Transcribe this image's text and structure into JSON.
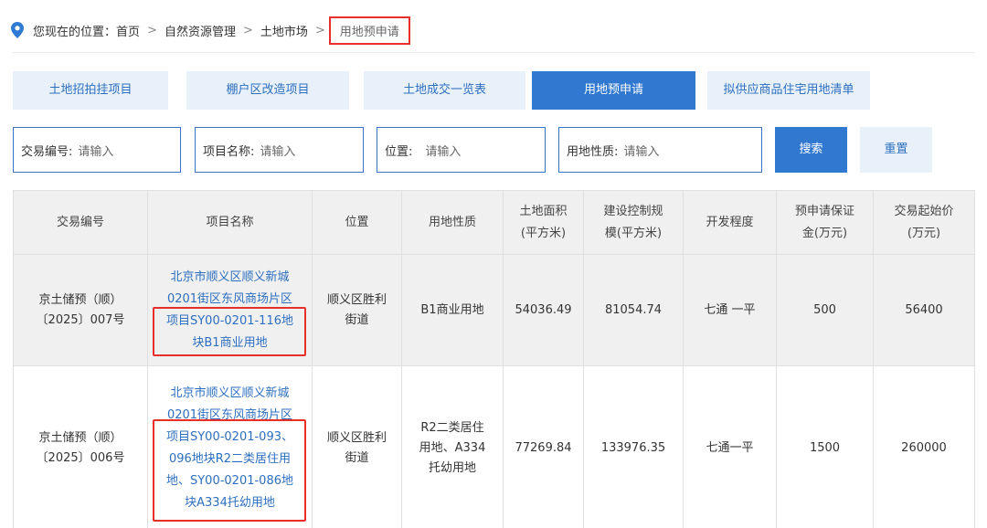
{
  "breadcrumb": {
    "prefix": "您现在的位置：",
    "items": [
      "首页",
      "自然资源管理",
      "土地市场"
    ],
    "current": "用地预申请",
    "separator": ">"
  },
  "tabs": [
    {
      "label": "土地招拍挂项目",
      "active": false
    },
    {
      "label": "棚户区改造项目",
      "active": false
    },
    {
      "label": "土地成交一览表",
      "active": false
    },
    {
      "label": "用地预申请",
      "active": true
    },
    {
      "label": "拟供应商品住宅用地清单",
      "active": false
    }
  ],
  "filters": [
    {
      "label": "交易编号:",
      "placeholder": "请输入"
    },
    {
      "label": "项目名称:",
      "placeholder": "请输入"
    },
    {
      "label": "位置:",
      "placeholder": "请输入"
    },
    {
      "label": "用地性质:",
      "placeholder": "请输入"
    }
  ],
  "buttons": {
    "search": "搜索",
    "reset": "重置"
  },
  "table": {
    "headers": [
      [
        "交易编号"
      ],
      [
        "项目名称"
      ],
      [
        "位置"
      ],
      [
        "用地性质"
      ],
      [
        "土地面积",
        "(平方米)"
      ],
      [
        "建设控制规",
        "模(平方米)"
      ],
      [
        "开发程度"
      ],
      [
        "预申请保证",
        "金(万元)"
      ],
      [
        "交易起始价",
        "(万元)"
      ]
    ],
    "rows": [
      {
        "code": [
          "京土储预（顺）",
          "〔2025〕007号"
        ],
        "name": [
          "北京市顺义区顺义新城",
          "0201街区东风商场片区",
          "项目SY00-0201-116地",
          "块B1商业用地"
        ],
        "location": [
          "顺义区胜利",
          "街道"
        ],
        "usage": [
          "B1商业用地"
        ],
        "area": "54036.49",
        "scale": "81054.74",
        "dev": "七通 一平",
        "deposit": "500",
        "price": "56400"
      },
      {
        "code": [
          "京土储预（顺）",
          "〔2025〕006号"
        ],
        "name": [
          "北京市顺义区顺义新城",
          "0201街区东风商场片区",
          "项目SY00-0201-093、",
          "096地块R2二类居住用",
          "地、SY00-0201-086地",
          "块A334托幼用地"
        ],
        "location": [
          "顺义区胜利",
          "街道"
        ],
        "usage": [
          "R2二类居住",
          "用地、A334",
          "托幼用地"
        ],
        "area": "77269.84",
        "scale": "133976.35",
        "dev": "七通一平",
        "deposit": "1500",
        "price": "260000"
      }
    ]
  },
  "colors": {
    "accent": "#3078d0",
    "tab_bg": "#e8f0fa",
    "link": "#2d6fc0",
    "highlight": "#e8302b",
    "pin": "#2f7bd4"
  },
  "icons": {
    "location": "location-pin-icon"
  }
}
